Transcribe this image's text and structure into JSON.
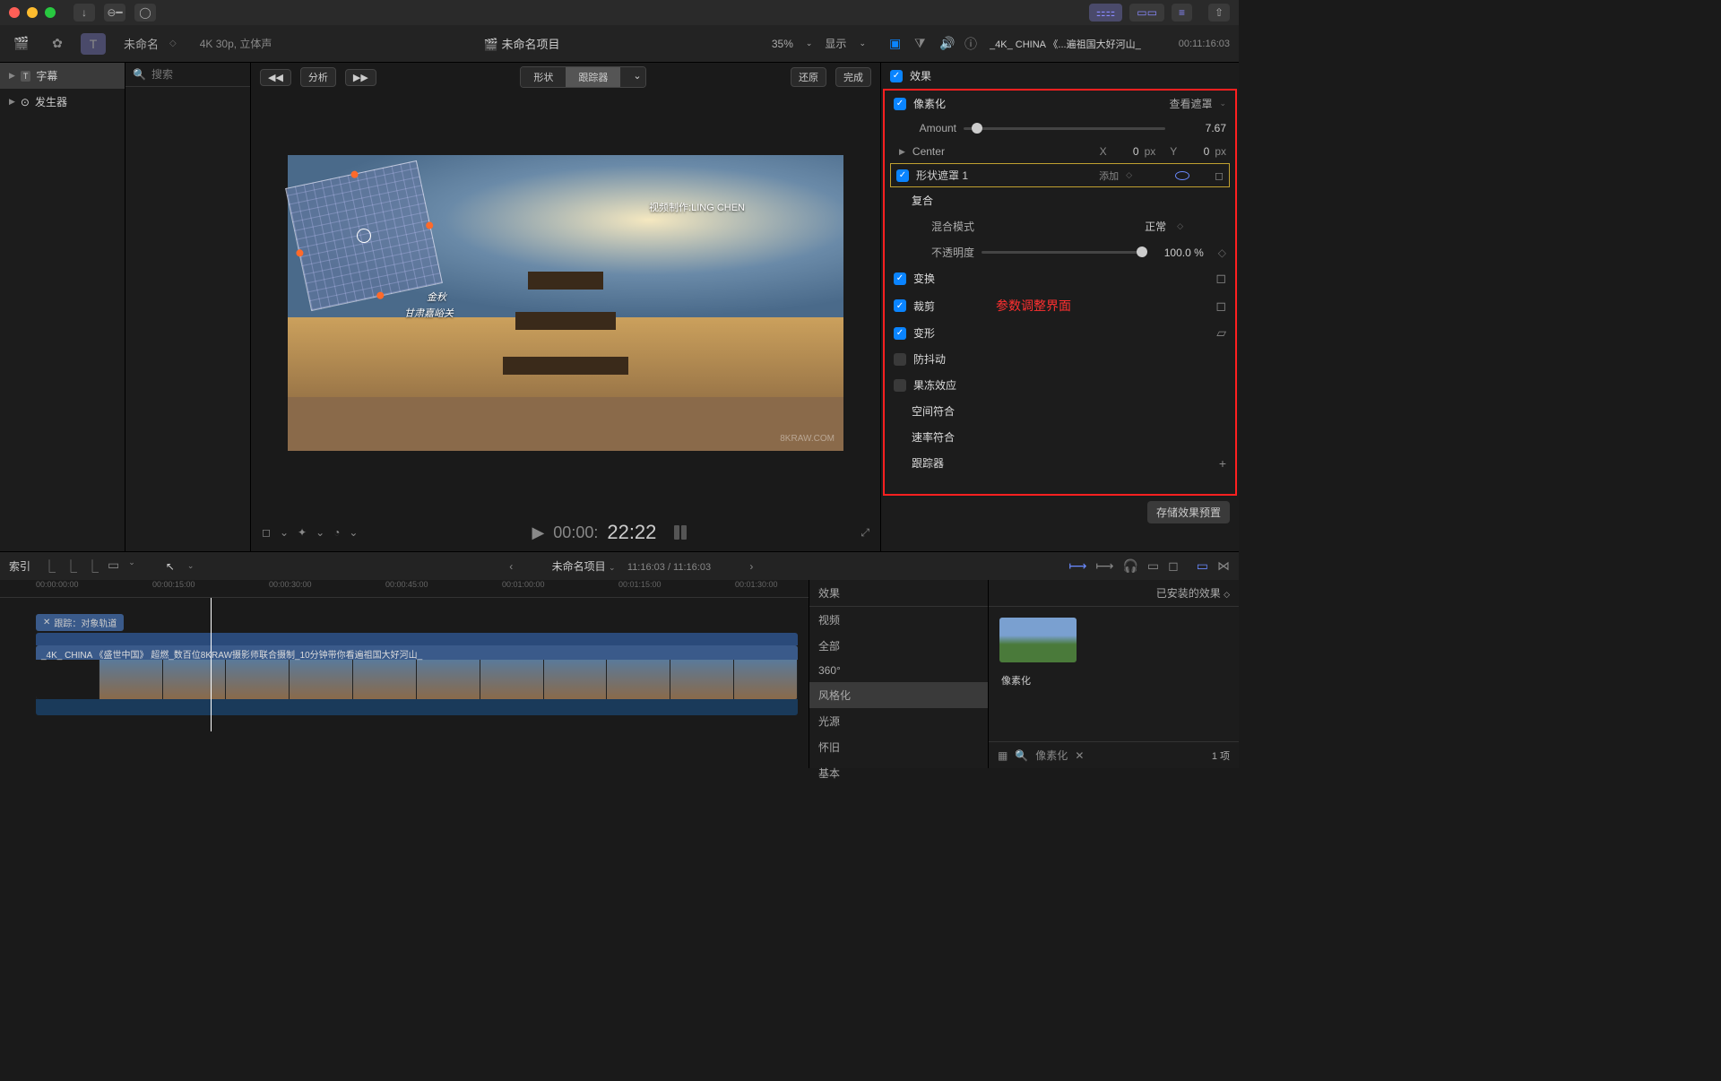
{
  "titlebar": {
    "share_icon": "share"
  },
  "toolbar": {
    "library_name": "未命名",
    "project_format": "4K 30p, 立体声",
    "project_name": "未命名项目",
    "zoom": "35%",
    "view_label": "显示"
  },
  "inspector_header": {
    "clip_name": "_4K_ CHINA 《...遍祖国大好河山_",
    "timecode": "00:11:16:03"
  },
  "sidebar": {
    "items": [
      {
        "label": "字幕",
        "icon": "T"
      },
      {
        "label": "发生器",
        "icon": "⊕"
      }
    ]
  },
  "browser": {
    "search_placeholder": "搜索"
  },
  "viewer": {
    "analyze_label": "分析",
    "seg_shape": "形状",
    "seg_tracker": "跟踪器",
    "revert_label": "还原",
    "done_label": "完成",
    "overlay_credit": "视频制作:LING CHEN",
    "overlay_title": "金秋",
    "overlay_sub": "甘肃嘉峪关",
    "watermark": "8KRAW.COM",
    "timecode": "00:00:22:22",
    "timecode_big": "22:22",
    "timecode_small": "00:00:"
  },
  "inspector": {
    "effects_header": "效果",
    "pixelate_label": "像素化",
    "view_mask_label": "查看遮罩",
    "amount_label": "Amount",
    "amount_value": "7.67",
    "center_label": "Center",
    "center_x_label": "X",
    "center_x_value": "0",
    "center_x_unit": "px",
    "center_y_label": "Y",
    "center_y_value": "0",
    "center_y_unit": "px",
    "shape_mask_label": "形状遮罩 1",
    "add_label": "添加",
    "composite_label": "复合",
    "blend_mode_label": "混合模式",
    "blend_mode_value": "正常",
    "opacity_label": "不透明度",
    "opacity_value": "100.0 %",
    "transform_label": "变换",
    "crop_label": "裁剪",
    "distort_label": "变形",
    "stabilize_label": "防抖动",
    "rolling_label": "果冻效应",
    "spatial_label": "空间符合",
    "rate_label": "速率符合",
    "tracker_label": "跟踪器",
    "annotation": "参数调整界面",
    "save_preset_label": "存储效果预置"
  },
  "timeline_header": {
    "index_label": "索引",
    "project_name": "未命名项目",
    "time_display": "11:16:03 / 11:16:03"
  },
  "timeline": {
    "ruler": [
      "00:00:00:00",
      "00:00:15:00",
      "00:00:30:00",
      "00:00:45:00",
      "00:01:00:00",
      "00:01:15:00",
      "00:01:30:00"
    ],
    "track_tag": "跟踪：对象轨道",
    "clip_name": "_4K_ CHINA 《盛世中国》 超燃_数百位8KRAW摄影师联合摄制_10分钟带你看遍祖国大好河山_"
  },
  "fx_browser": {
    "header": "效果",
    "categories": [
      "视频",
      "全部",
      "360°",
      "风格化",
      "光源",
      "怀旧",
      "基本"
    ],
    "selected": "风格化"
  },
  "fx_preview": {
    "header": "已安装的效果",
    "thumb_label": "像素化",
    "search_value": "像素化",
    "count_label": "1 项"
  }
}
